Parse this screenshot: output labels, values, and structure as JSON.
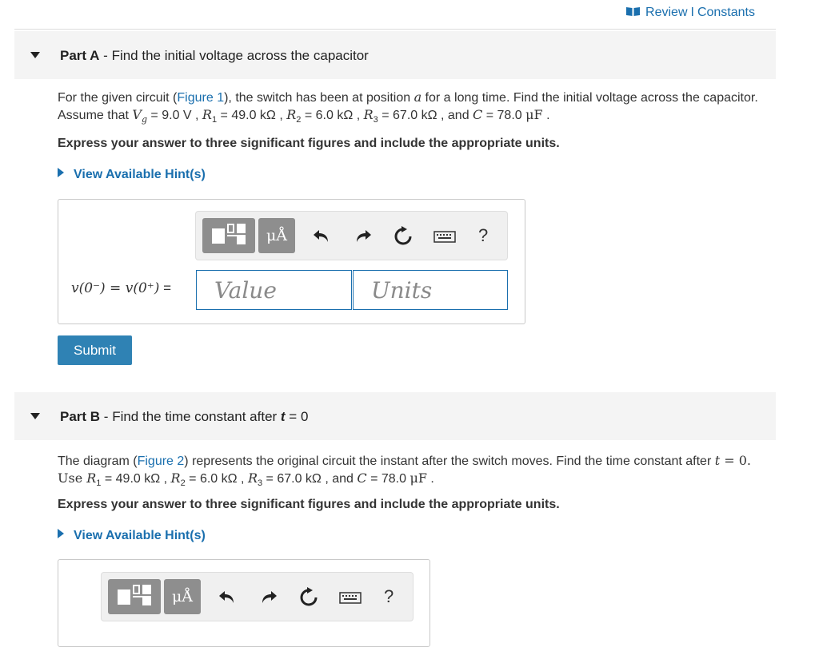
{
  "header": {
    "review_label": "Review",
    "separator": "I",
    "constants_label": "Constants"
  },
  "part_a": {
    "label": "Part A",
    "dash": " - ",
    "title": "Find the initial voltage across the capacitor",
    "problem": {
      "t1": "For the given circuit (",
      "figure_link": "Figure 1",
      "t2": "), the switch has been at position ",
      "pos": "a",
      "t3": " for a long time. Find the initial voltage across the capacitor. Assume that ",
      "vg": "V",
      "vg_sub": "g",
      "vg_val": " = 9.0 V ",
      "r1": "R",
      "r1_sub": "1",
      "r1_val": " = 49.0 kΩ ",
      "r2": "R",
      "r2_sub": "2",
      "r2_val": " = 6.0 kΩ ",
      "r3": "R",
      "r3_sub": "3",
      "r3_val": " = 67.0 kΩ ",
      "and": ", and ",
      "c": "C",
      "c_val": " = 78.0 ",
      "c_unit": "μF",
      "end": " ."
    },
    "instruction": "Express your answer to three significant figures and include the appropriate units.",
    "hint_label": "View Available Hint(s)",
    "lhs": "v(0⁻) = v(0⁺)",
    "lhs_eq": " =",
    "value_placeholder": "Value",
    "units_placeholder": "Units",
    "submit_label": "Submit"
  },
  "part_b": {
    "label": "Part B",
    "dash": " - ",
    "title_pre": "Find the time constant after ",
    "title_var": "t",
    "title_post": " = 0",
    "problem": {
      "t1": "The diagram (",
      "figure_link": "Figure 2",
      "t2": ") represents the original circuit the instant after the switch moves. Find the time constant after ",
      "t": "t",
      "t_val": " = 0. Use ",
      "r1": "R",
      "r1_sub": "1",
      "r1_val": " = 49.0 kΩ ",
      "r2": "R",
      "r2_sub": "2",
      "r2_val": " = 6.0 kΩ ",
      "r3": "R",
      "r3_sub": "3",
      "r3_val": " = 67.0 kΩ ",
      "and": ", and ",
      "c": "C",
      "c_val": " = 78.0 ",
      "c_unit": "μF",
      "end": " ."
    },
    "instruction": "Express your answer to three significant figures and include the appropriate units.",
    "hint_label": "View Available Hint(s)"
  },
  "toolbar": {
    "units_label": "μÅ",
    "help_label": "?",
    "icons": [
      "templates-icon",
      "units-icon",
      "undo-icon",
      "redo-icon",
      "reset-icon",
      "keyboard-icon",
      "help-icon"
    ]
  },
  "colors": {
    "link": "#1a6fae",
    "submit_bg": "#2f82b4",
    "part_header_bg": "#f4f4f4",
    "toolbar_btn": "#8e8e8e"
  }
}
